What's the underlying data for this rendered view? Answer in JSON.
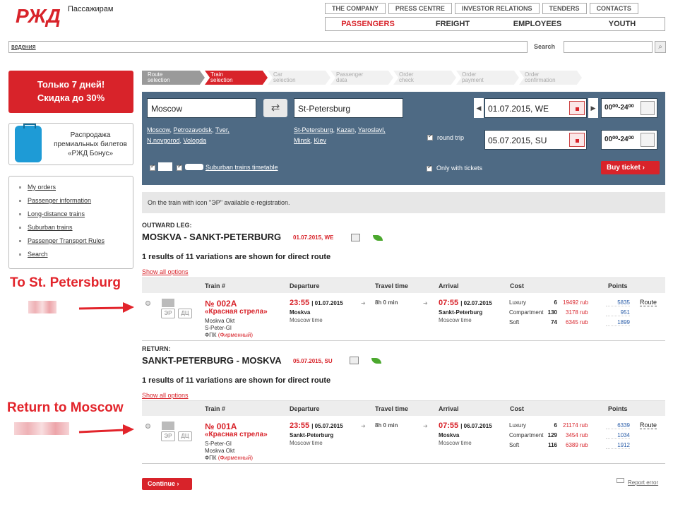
{
  "header": {
    "logo_text": "Пассажирам",
    "top_nav": [
      "THE COMPANY",
      "PRESS CENTRE",
      "INVESTOR RELATIONS",
      "TENDERS",
      "CONTACTS"
    ],
    "main_nav": [
      "PASSENGERS",
      "FREIGHT",
      "EMPLOYEES",
      "YOUTH"
    ],
    "top_input_value": "ведения",
    "search_label": "Search"
  },
  "sidebar": {
    "promo_line1": "Только 7 дней!",
    "promo_line2": "Скидка до 30%",
    "bonus_line1": "Распродажа",
    "bonus_line2": "премиальных билетов",
    "bonus_line3": "«РЖД Бонус»",
    "menu": [
      "My orders",
      "Passenger information",
      "Long-distance trains",
      "Suburban trains",
      "Passenger Transport Rules",
      "Search"
    ]
  },
  "annotations": {
    "outward": "To St. Petersburg",
    "return": "Return to Moscow"
  },
  "steps": [
    {
      "l1": "Route",
      "l2": "selection",
      "state": "done"
    },
    {
      "l1": "Train",
      "l2": "selection",
      "state": "active"
    },
    {
      "l1": "Car",
      "l2": "selection",
      "state": "todo"
    },
    {
      "l1": "Passenger",
      "l2": "data",
      "state": "todo"
    },
    {
      "l1": "Order",
      "l2": "check",
      "state": "todo"
    },
    {
      "l1": "Order",
      "l2": "payment",
      "state": "todo"
    },
    {
      "l1": "Order",
      "l2": "confirmation",
      "state": "todo"
    }
  ],
  "panel": {
    "from": "Moscow",
    "to": "St-Petersburg",
    "from_sugg_1": [
      "Moscow",
      "Petrozavodsk",
      "Tver,"
    ],
    "from_sugg_2": [
      "N.novgorod",
      "Vologda"
    ],
    "to_sugg_1": [
      "St-Petersburg",
      "Kazan",
      "Yaroslavl,"
    ],
    "to_sugg_2": [
      "Minsk",
      "Kiev"
    ],
    "date_out": "01.07.2015, WE",
    "date_back": "05.07.2015, SU",
    "time_range": "00⁰⁰-24⁰⁰",
    "round_trip": "round trip",
    "suburban": "Suburban trains timetable",
    "only_tickets": "Only with tickets",
    "buy_button": "Buy ticket"
  },
  "info_bar": "On the train with icon \"ЭР\" available e-registration.",
  "outward": {
    "leg_label": "OUTWARD LEG:",
    "title": "MOSKVA - SANKT-PETERBURG",
    "date": "01.07.2015, WE",
    "results": "1 results of 11 variations are shown for direct route",
    "show_all": "Show all options"
  },
  "return_leg": {
    "leg_label": "RETURN:",
    "title": "SANKT-PETERBURG - MOSKVA",
    "date": "05.07.2015, SU",
    "results": "1 results of 11 variations are shown for direct route",
    "show_all": "Show all options"
  },
  "table_headers": {
    "train": "Train #",
    "departure": "Departure",
    "travel": "Travel time",
    "arrival": "Arrival",
    "cost": "Cost",
    "points": "Points"
  },
  "badges": {
    "er": "ЭР",
    "dc": "ДЦ"
  },
  "trains": [
    {
      "number": "№ 002А",
      "name": "«Красная стрела»",
      "route1": "Moskva Okt",
      "route2": "S-Peter-Gl",
      "carrier": "ФПК",
      "carrier_type": "(Фирменный)",
      "dep_time": "23:55",
      "dep_date": "| 01.07.2015",
      "dep_place": "Moskva",
      "dep_tz": "Moscow time",
      "travel": "8h 0 min",
      "arr_time": "07:55",
      "arr_date": "| 02.07.2015",
      "arr_place": "Sankt-Peterburg",
      "arr_tz": "Moscow time",
      "classes": [
        {
          "name": "Luxury",
          "count": "6",
          "price": "19492 rub",
          "points": "5835"
        },
        {
          "name": "Compartment",
          "count": "130",
          "price": "3178 rub",
          "points": "951"
        },
        {
          "name": "Soft",
          "count": "74",
          "price": "6345 rub",
          "points": "1899"
        }
      ],
      "route_link": "Route"
    },
    {
      "number": "№ 001А",
      "name": "«Красная стрела»",
      "route1": "S-Peter-Gl",
      "route2": "Moskva Okt",
      "carrier": "ФПК",
      "carrier_type": "(Фирменный)",
      "dep_time": "23:55",
      "dep_date": "| 05.07.2015",
      "dep_place": "Sankt-Peterburg",
      "dep_tz": "Moscow time",
      "travel": "8h 0 min",
      "arr_time": "07:55",
      "arr_date": "| 06.07.2015",
      "arr_place": "Moskva",
      "arr_tz": "Moscow time",
      "classes": [
        {
          "name": "Luxury",
          "count": "6",
          "price": "21174 rub",
          "points": "6339"
        },
        {
          "name": "Compartment",
          "count": "129",
          "price": "3454 rub",
          "points": "1034"
        },
        {
          "name": "Soft",
          "count": "116",
          "price": "6389 rub",
          "points": "1912"
        }
      ],
      "route_link": "Route"
    }
  ],
  "footer": {
    "continue": "Continue",
    "report": "Report error"
  }
}
